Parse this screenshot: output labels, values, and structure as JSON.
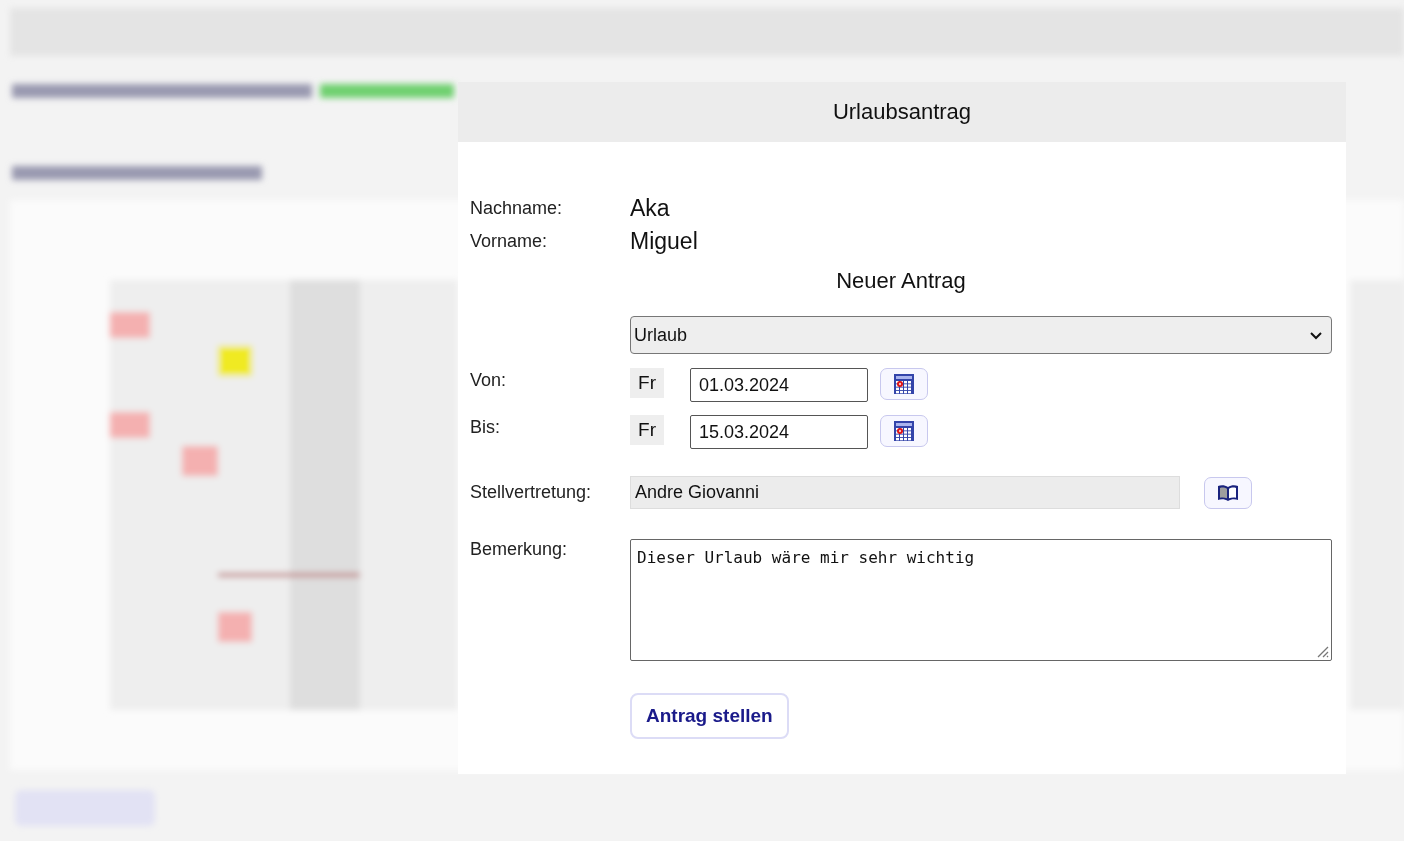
{
  "dialog": {
    "title": "Urlaubsantrag",
    "person": [
      {
        "label": "Nachname:",
        "value": "Aka"
      },
      {
        "label": "Vorname:",
        "value": "Miguel"
      }
    ],
    "section_title": "Neuer Antrag",
    "type_dropdown": {
      "value": "Urlaub"
    },
    "dates": [
      {
        "label": "Von:",
        "weekday": "Fr",
        "value": "01.03.2024"
      },
      {
        "label": "Bis:",
        "weekday": "Fr",
        "value": "15.03.2024"
      }
    ],
    "deputy": {
      "label": "Stellvertretung:",
      "value": "Andre Giovanni"
    },
    "remark": {
      "label": "Bemerkung:",
      "value": "Dieser Urlaub wäre mir sehr wichtig"
    },
    "submit_button": "Antrag stellen"
  }
}
